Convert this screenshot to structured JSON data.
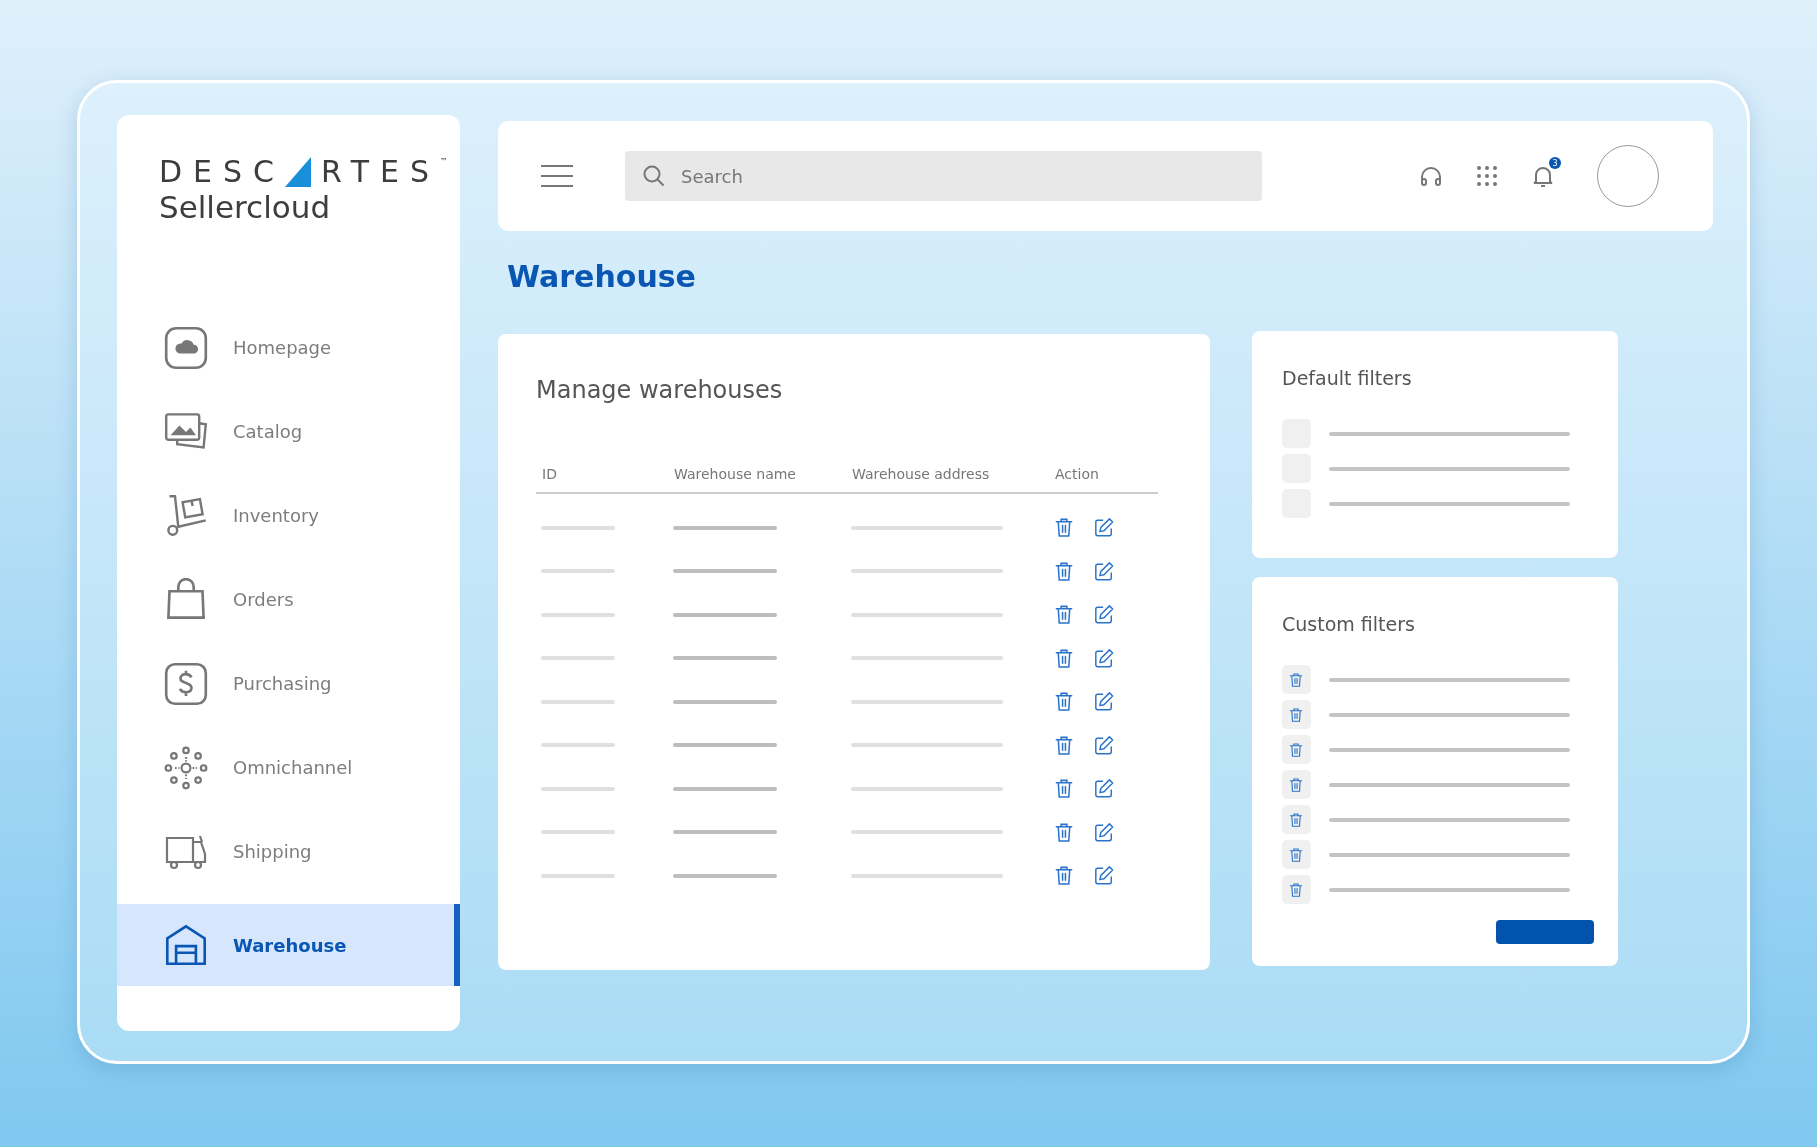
{
  "logo": {
    "brand_left": "DESC",
    "brand_right": "RTES",
    "trademark": "™",
    "product": "Sellercloud"
  },
  "sidebar": {
    "items": [
      {
        "label": "Homepage",
        "kind": "cloud",
        "selected": false
      },
      {
        "label": "Catalog",
        "kind": "images",
        "selected": false
      },
      {
        "label": "Inventory",
        "kind": "cart",
        "selected": false
      },
      {
        "label": "Orders",
        "kind": "bag",
        "selected": false
      },
      {
        "label": "Purchasing",
        "kind": "dollar",
        "selected": false
      },
      {
        "label": "Omnichannel",
        "kind": "network",
        "selected": false
      },
      {
        "label": "Shipping",
        "kind": "truck",
        "selected": false
      },
      {
        "label": "Warehouse",
        "kind": "warehouse",
        "selected": true
      }
    ]
  },
  "topbar": {
    "search": {
      "placeholder": "Search"
    },
    "notifications": {
      "badge": "3"
    }
  },
  "page_title": "Warehouse",
  "manage": {
    "title": "Manage warehouses",
    "columns": [
      "ID",
      "Warehouse name",
      "Warehouse address",
      "Action"
    ],
    "rows": [
      {
        "kind": "placeholder"
      },
      {
        "kind": "placeholder"
      },
      {
        "kind": "placeholder"
      },
      {
        "kind": "placeholder"
      },
      {
        "kind": "placeholder"
      },
      {
        "kind": "placeholder"
      },
      {
        "kind": "placeholder"
      },
      {
        "kind": "placeholder"
      },
      {
        "kind": "placeholder"
      }
    ]
  },
  "default_filters": {
    "title": "Default filters",
    "items": [
      {
        "kind": "blank",
        "checked": false
      },
      {
        "kind": "blank",
        "checked": false
      },
      {
        "kind": "blank",
        "checked": false
      }
    ]
  },
  "custom_filters": {
    "title": "Custom filters",
    "items": [
      {
        "kind": "deletable"
      },
      {
        "kind": "deletable"
      },
      {
        "kind": "deletable"
      },
      {
        "kind": "deletable"
      },
      {
        "kind": "deletable"
      },
      {
        "kind": "deletable"
      },
      {
        "kind": "deletable"
      }
    ]
  }
}
